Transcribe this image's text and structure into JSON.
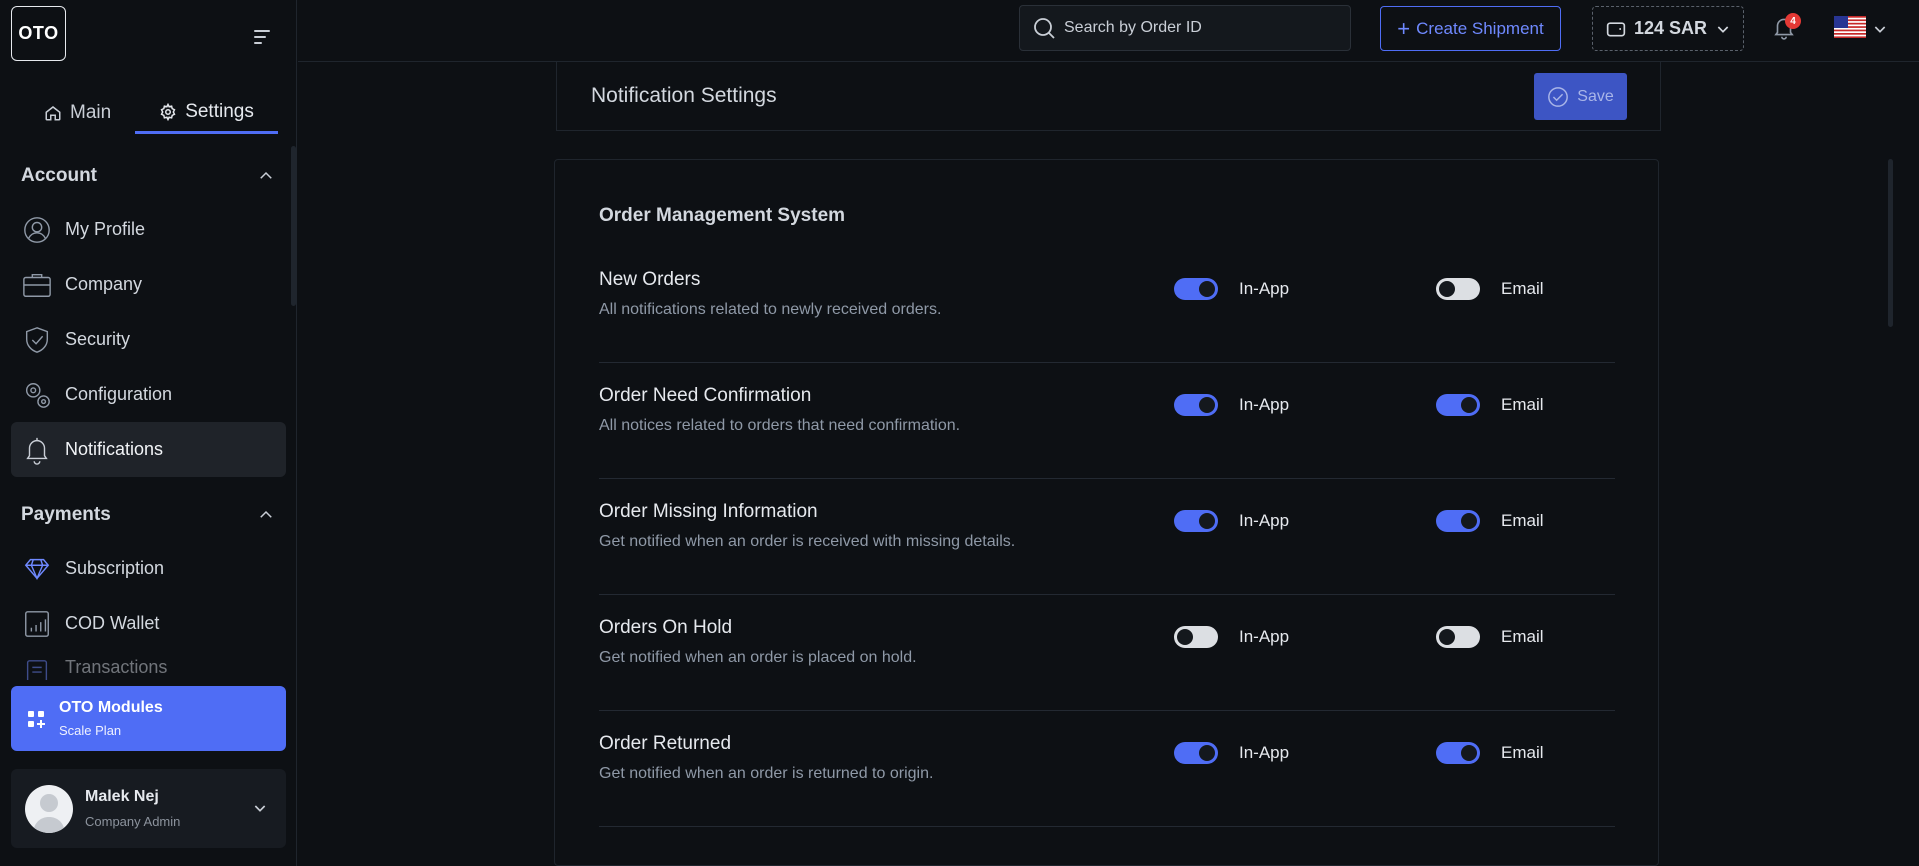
{
  "app": {
    "logo_text": "OTO"
  },
  "sidebar": {
    "tabs": [
      {
        "label": "Main",
        "icon": "home-icon"
      },
      {
        "label": "Settings",
        "icon": "gear-icon"
      }
    ],
    "sections": [
      {
        "title": "Account",
        "items": [
          {
            "label": "My Profile",
            "icon": "user-icon"
          },
          {
            "label": "Company",
            "icon": "briefcase-icon"
          },
          {
            "label": "Security",
            "icon": "shield-icon"
          },
          {
            "label": "Configuration",
            "icon": "gears-icon"
          },
          {
            "label": "Notifications",
            "icon": "bell-icon",
            "active": true
          }
        ]
      },
      {
        "title": "Payments",
        "items": [
          {
            "label": "Subscription",
            "icon": "diamond-icon"
          },
          {
            "label": "COD Wallet",
            "icon": "wallet-chart-icon"
          },
          {
            "label": "Transactions",
            "icon": "receipt-icon"
          }
        ]
      }
    ],
    "modules": {
      "title": "OTO Modules",
      "subtitle": "Scale Plan"
    },
    "user": {
      "name": "Malek Nej",
      "role": "Company Admin"
    }
  },
  "topbar": {
    "search_placeholder": "Search by Order ID",
    "create_label": "Create Shipment",
    "wallet_label": "124 SAR",
    "notification_count": "4"
  },
  "page": {
    "title": "Notification Settings",
    "save_label": "Save"
  },
  "notifications": {
    "group_title": "Order Management System",
    "inapp_label": "In-App",
    "email_label": "Email",
    "rows": [
      {
        "title": "New Orders",
        "desc": "All notifications related to newly received orders.",
        "inapp": true,
        "email": false
      },
      {
        "title": "Order Need Confirmation",
        "desc": "All notices related to orders that need confirmation.",
        "inapp": true,
        "email": true
      },
      {
        "title": "Order Missing Information",
        "desc": "Get notified when an order is received with missing details.",
        "inapp": true,
        "email": true
      },
      {
        "title": "Orders On Hold",
        "desc": "Get notified when an order is placed on hold.",
        "inapp": false,
        "email": false
      },
      {
        "title": "Order Returned",
        "desc": "Get notified when an order is returned to origin.",
        "inapp": true,
        "email": true
      }
    ]
  },
  "colors": {
    "accent": "#4f6df5",
    "background": "#0d1014",
    "badge": "#e53935"
  }
}
